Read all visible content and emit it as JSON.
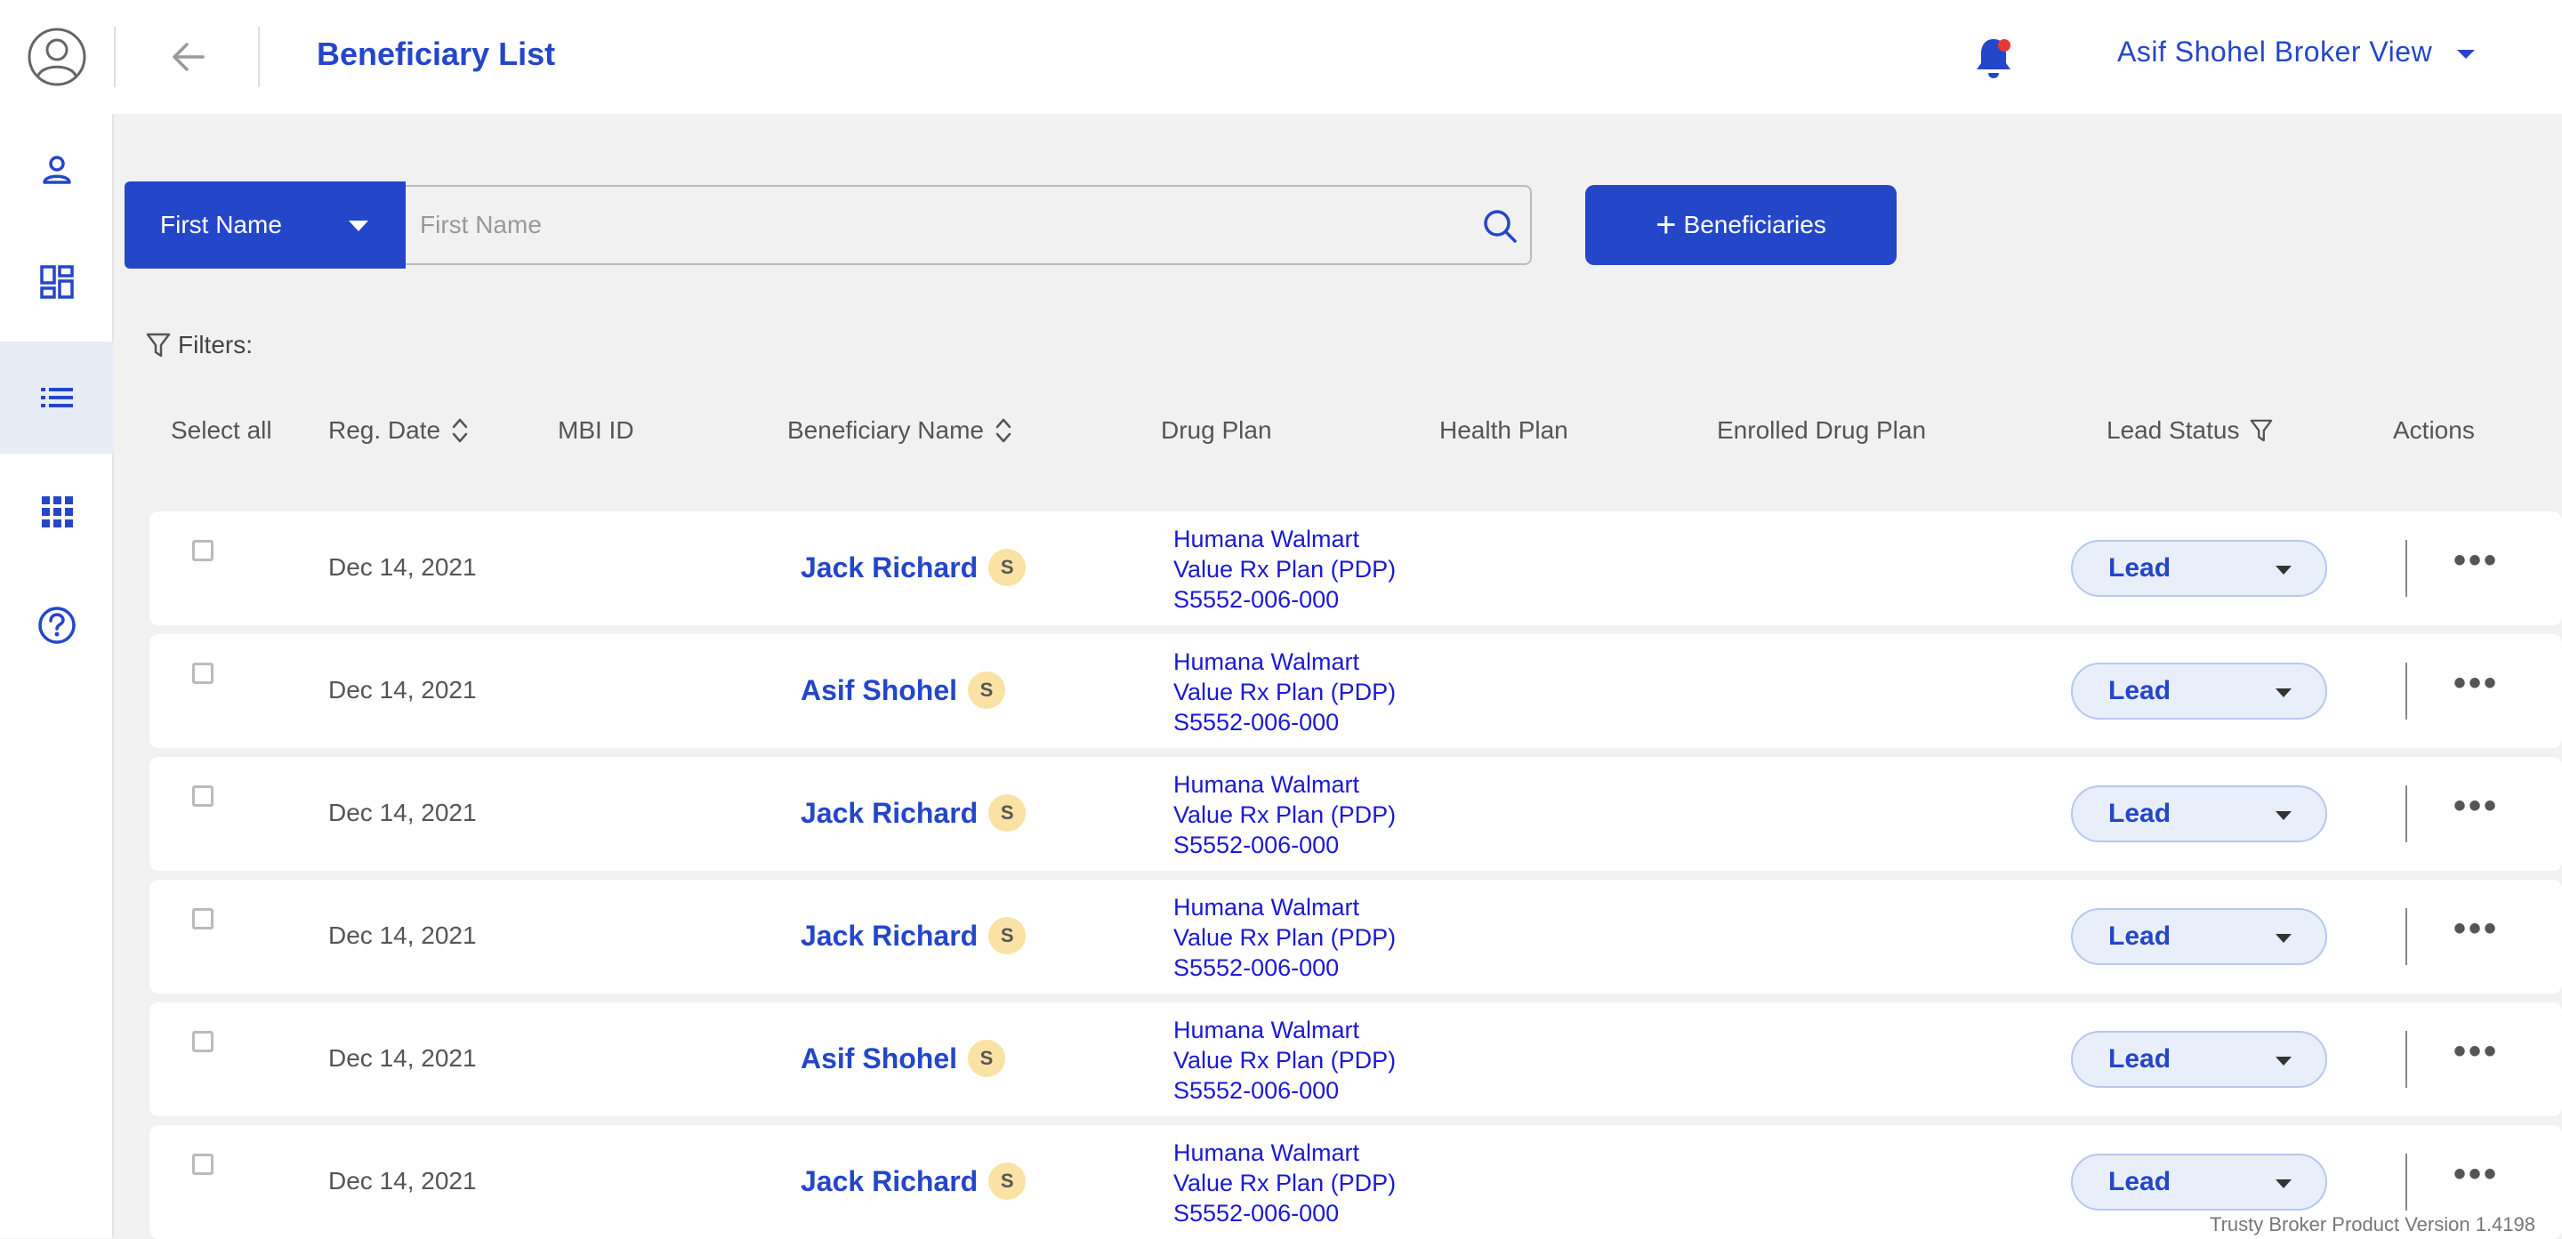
{
  "header": {
    "title": "Beneficiary List",
    "user_menu_label": "Asif Shohel Broker View"
  },
  "search": {
    "field_type": "First Name",
    "placeholder": "First Name",
    "add_button_label": "Beneficiaries"
  },
  "filters_label": "Filters:",
  "table": {
    "columns": {
      "select_all": "Select all",
      "reg_date": "Reg. Date",
      "mbi_id": "MBI ID",
      "beneficiary_name": "Beneficiary Name",
      "drug_plan": "Drug Plan",
      "health_plan": "Health Plan",
      "enrolled_drug_plan": "Enrolled Drug Plan",
      "lead_status": "Lead Status",
      "actions": "Actions"
    },
    "rows": [
      {
        "reg_date": "Dec 14, 2021",
        "name": "Jack Richard",
        "badge": "S",
        "plan_line1": "Humana Walmart",
        "plan_line2": "Value Rx Plan (PDP)",
        "plan_line3": "S5552-006-000",
        "status": "Lead"
      },
      {
        "reg_date": "Dec 14, 2021",
        "name": "Asif Shohel",
        "badge": "S",
        "plan_line1": "Humana Walmart",
        "plan_line2": "Value Rx Plan (PDP)",
        "plan_line3": "S5552-006-000",
        "status": "Lead"
      },
      {
        "reg_date": "Dec 14, 2021",
        "name": "Jack Richard",
        "badge": "S",
        "plan_line1": "Humana Walmart",
        "plan_line2": "Value Rx Plan (PDP)",
        "plan_line3": "S5552-006-000",
        "status": "Lead"
      },
      {
        "reg_date": "Dec 14, 2021",
        "name": "Jack Richard",
        "badge": "S",
        "plan_line1": "Humana Walmart",
        "plan_line2": "Value Rx Plan (PDP)",
        "plan_line3": "S5552-006-000",
        "status": "Lead"
      },
      {
        "reg_date": "Dec 14, 2021",
        "name": "Asif Shohel",
        "badge": "S",
        "plan_line1": "Humana Walmart",
        "plan_line2": "Value Rx Plan (PDP)",
        "plan_line3": "S5552-006-000",
        "status": "Lead"
      },
      {
        "reg_date": "Dec 14, 2021",
        "name": "Jack Richard",
        "badge": "S",
        "plan_line1": "Humana Walmart",
        "plan_line2": "Value Rx Plan (PDP)",
        "plan_line3": "S5552-006-000",
        "status": "Lead"
      }
    ]
  },
  "footer": {
    "version": "Trusty Broker Product Version 1.4198"
  },
  "colors": {
    "accent": "#2446c9",
    "plan_link": "#1a1ad4",
    "badge": "#f9e2a4",
    "notification_dot": "#e53935"
  },
  "icons": [
    "user-avatar-icon",
    "back-arrow-icon",
    "bell-icon",
    "person-icon",
    "dashboard-icon",
    "list-icon",
    "apps-grid-icon",
    "help-icon",
    "search-icon",
    "filter-icon",
    "sort-icon"
  ]
}
